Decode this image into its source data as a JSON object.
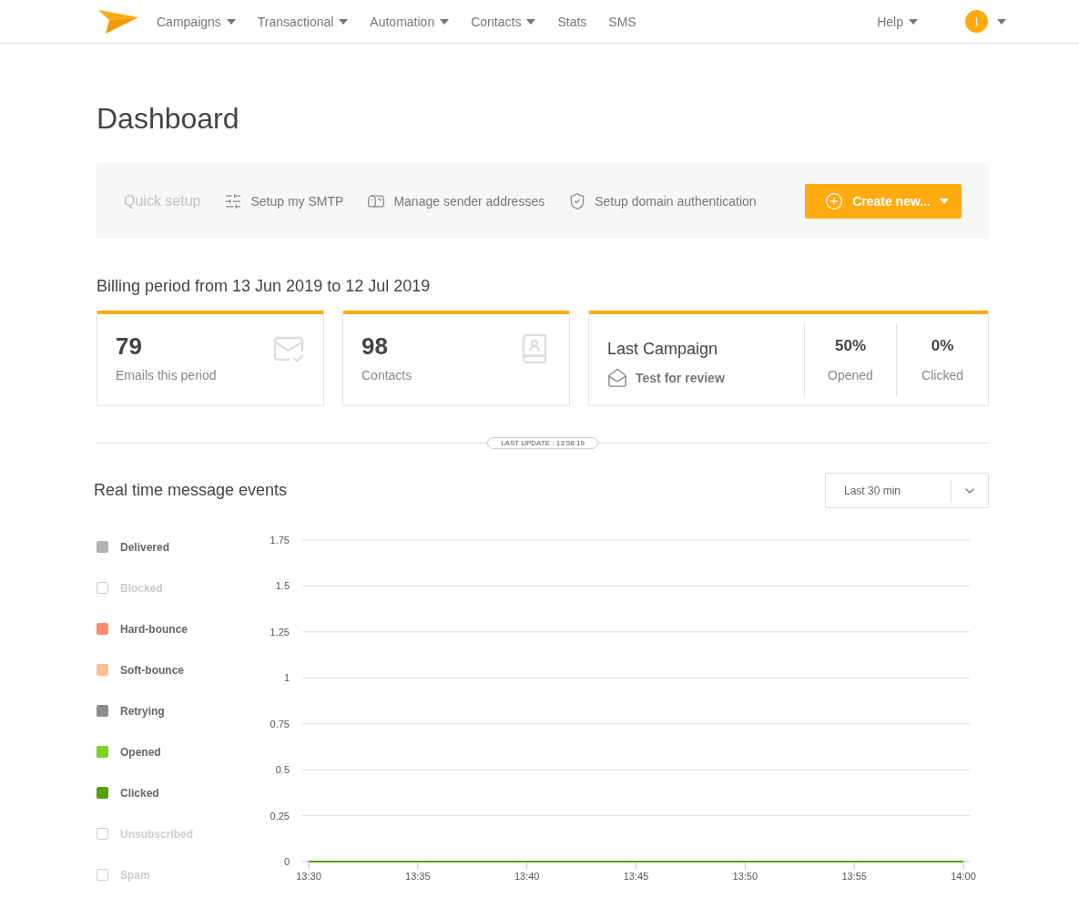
{
  "nav": {
    "items": [
      {
        "label": "Campaigns",
        "dropdown": true
      },
      {
        "label": "Transactional",
        "dropdown": true
      },
      {
        "label": "Automation",
        "dropdown": true
      },
      {
        "label": "Contacts",
        "dropdown": true
      },
      {
        "label": "Stats",
        "dropdown": false
      },
      {
        "label": "SMS",
        "dropdown": false
      }
    ],
    "help": "Help",
    "avatar_initial": "I"
  },
  "page_title": "Dashboard",
  "quick_setup": {
    "label": "Quick setup",
    "actions": [
      {
        "label": "Setup my SMTP",
        "kind": "smtp"
      },
      {
        "label": "Manage sender addresses",
        "kind": "sender"
      },
      {
        "label": "Setup domain authentication",
        "kind": "domain"
      }
    ],
    "create_button": "Create new..."
  },
  "billing_period": "Billing period from 13 Jun 2019 to 12 Jul 2019",
  "stats": [
    {
      "value": "79",
      "label": "Emails this period",
      "kind": "emails"
    },
    {
      "value": "98",
      "label": "Contacts",
      "kind": "contacts"
    }
  ],
  "last_campaign": {
    "title": "Last Campaign",
    "name": "Test for review",
    "metrics": [
      {
        "value": "50%",
        "label": "Opened"
      },
      {
        "value": "0%",
        "label": "Clicked"
      }
    ]
  },
  "last_update": "LAST UPDATE : 13:58:19",
  "events": {
    "title": "Real time message events",
    "range": "Last 30 min",
    "legend": [
      {
        "label": "Delivered",
        "checked": true,
        "color": "#b3b3b3"
      },
      {
        "label": "Blocked",
        "checked": false
      },
      {
        "label": "Hard-bounce",
        "checked": true,
        "color": "#ff8a6c"
      },
      {
        "label": "Soft-bounce",
        "checked": true,
        "color": "#ffbe98"
      },
      {
        "label": "Retrying",
        "checked": true,
        "color": "#8c8c8c"
      },
      {
        "label": "Opened",
        "checked": true,
        "color": "#7ed321"
      },
      {
        "label": "Clicked",
        "checked": true,
        "color": "#56a10b"
      },
      {
        "label": "Unsubscribed",
        "checked": false
      },
      {
        "label": "Spam",
        "checked": false
      }
    ],
    "chart_data": {
      "type": "line",
      "categories": [
        "13:30",
        "13:35",
        "13:40",
        "13:45",
        "13:50",
        "13:55",
        "14:00"
      ],
      "ylim": [
        0,
        1.75
      ],
      "grid": true,
      "yticks": [
        0,
        0.25,
        0.5,
        0.75,
        1,
        1.25,
        1.5,
        1.75
      ],
      "series": [
        {
          "color": "#56a10b",
          "values": [
            0,
            0,
            0,
            0,
            0,
            0,
            0
          ]
        }
      ]
    }
  }
}
